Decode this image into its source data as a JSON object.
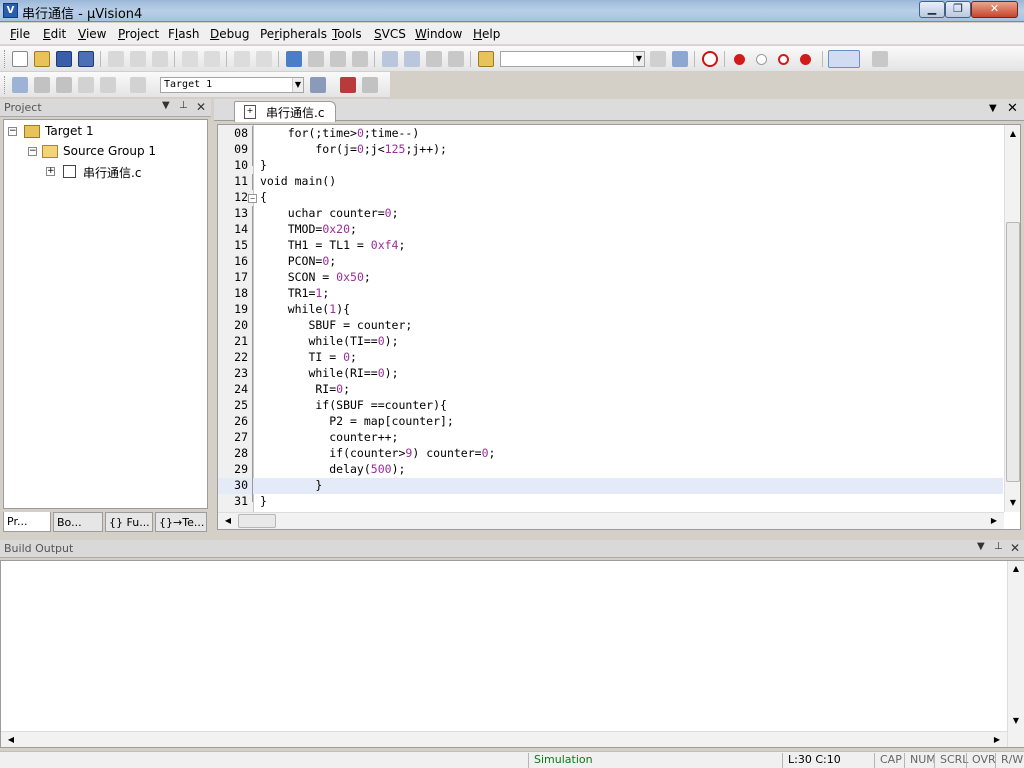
{
  "window": {
    "title": "串行通信  - µVision4",
    "app_icon": "V",
    "controls": {
      "minimize": "▁",
      "maximize": "❐",
      "close": "✕"
    }
  },
  "menu": [
    {
      "label": "File",
      "key": "F"
    },
    {
      "label": "Edit",
      "key": "E"
    },
    {
      "label": "View",
      "key": "V"
    },
    {
      "label": "Project",
      "key": "P"
    },
    {
      "label": "Flash",
      "key": "l"
    },
    {
      "label": "Debug",
      "key": "D"
    },
    {
      "label": "Peripherals",
      "key": "r"
    },
    {
      "label": "Tools",
      "key": "T"
    },
    {
      "label": "SVCS",
      "key": "S"
    },
    {
      "label": "Window",
      "key": "W"
    },
    {
      "label": "Help",
      "key": "H"
    }
  ],
  "toolbar": {
    "target_combo": "Target 1",
    "find_combo": ""
  },
  "project": {
    "title": "Project",
    "target": "Target 1",
    "group": "Source Group 1",
    "file": "串行通信.c",
    "tabs": [
      "Pr...",
      "Bo...",
      "{} Fu...",
      "{}→Te..."
    ]
  },
  "editor": {
    "tab": "串行通信.c",
    "lines": [
      {
        "n": "08",
        "text": "    for(;time>0;time--)"
      },
      {
        "n": "09",
        "text": "        for(j=0;j<125;j++);"
      },
      {
        "n": "10",
        "text": "}"
      },
      {
        "n": "11",
        "text": "void main()"
      },
      {
        "n": "12",
        "text": "{"
      },
      {
        "n": "13",
        "text": "    uchar counter=0;"
      },
      {
        "n": "14",
        "text": "    TMOD=0x20;"
      },
      {
        "n": "15",
        "text": "    TH1 = TL1 = 0xf4;"
      },
      {
        "n": "16",
        "text": "    PCON=0;"
      },
      {
        "n": "17",
        "text": "    SCON = 0x50;"
      },
      {
        "n": "18",
        "text": "    TR1=1;"
      },
      {
        "n": "19",
        "text": "    while(1){"
      },
      {
        "n": "20",
        "text": "       SBUF = counter;"
      },
      {
        "n": "21",
        "text": "       while(TI==0);"
      },
      {
        "n": "22",
        "text": "       TI = 0;"
      },
      {
        "n": "23",
        "text": "       while(RI==0);"
      },
      {
        "n": "24",
        "text": "        RI=0;"
      },
      {
        "n": "25",
        "text": "        if(SBUF ==counter){"
      },
      {
        "n": "26",
        "text": "          P2 = map[counter];"
      },
      {
        "n": "27",
        "text": "          counter++;"
      },
      {
        "n": "28",
        "text": "          if(counter>9) counter=0;"
      },
      {
        "n": "29",
        "text": "          delay(500);"
      },
      {
        "n": "30",
        "text": "        }"
      },
      {
        "n": "31",
        "text": "}"
      }
    ],
    "current_line": "30"
  },
  "build_output": {
    "title": "Build Output",
    "text": ""
  },
  "status": {
    "mode": "Simulation",
    "position": "L:30 C:10",
    "cap": "CAP",
    "num": "NUM",
    "scrl": "SCRL",
    "ovr": "OVR",
    "rw": "R/W"
  },
  "colors": {
    "number": "#9a2d9a",
    "current_line": "#e5eaf8",
    "status_mode": "#0a7a18"
  }
}
